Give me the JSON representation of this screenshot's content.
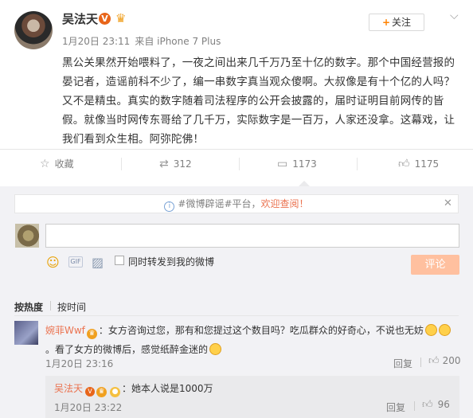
{
  "post": {
    "author": "吴法天",
    "verified_badge": "V",
    "time": "1月20日 23:11",
    "source": "来自 iPhone 7 Plus",
    "follow_label": "关注",
    "text": "黑公关果然开始喂料了，一夜之间出来几千万乃至十亿的数字。那个中国经营报的晏记者，造谣前科不少了，编一串数字真当观众傻啊。大叔像是有十个亿的人吗？又不是精虫。真实的数字随着司法程序的公开会披露的，届时证明目前网传的皆假。就像当时网传东哥给了几千万，实际数字是一百万，人家还没拿。这幕戏，让我们看到众生相。阿弥陀佛！"
  },
  "actions": {
    "favorite_label": "收藏",
    "repost_count": "312",
    "comment_count": "1173",
    "like_count": "1175"
  },
  "notice": {
    "prefix": "#微博辟谣#平台，",
    "highlight": "欢迎查阅！"
  },
  "composer": {
    "repost_checkbox_label": "同时转发到我的微博",
    "submit_label": "评论"
  },
  "sort": {
    "hot": "按热度",
    "time": "按时间"
  },
  "comment": {
    "author": "婉菲Wwf",
    "text1": "：女方咨询过您，那有和您提过这个数目吗？吃瓜群众的好奇心，不说也无妨",
    "text2": "。看了女方的微博后，感觉纸醉金迷的",
    "time": "1月20日 23:16",
    "reply_label": "回复",
    "likes": "200"
  },
  "sub_comment": {
    "author": "吴法天",
    "text": "：她本人说是1000万",
    "time": "1月20日 23:22",
    "reply_label": "回复",
    "likes": "96"
  }
}
